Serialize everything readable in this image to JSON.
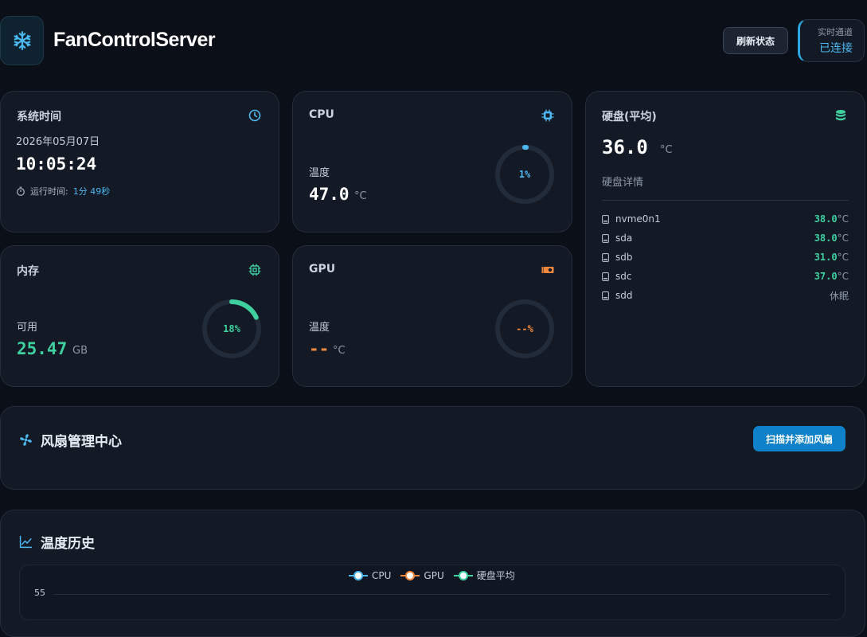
{
  "header": {
    "app_title": "FanControlServer",
    "logo_icon": "snowflake-icon",
    "refresh_label": "刷新状态",
    "connection_label": "实时通道",
    "connection_status": "已连接"
  },
  "system_time": {
    "title": "系统时间",
    "icon": "clock-icon",
    "date": "2026年05月07日",
    "time": "10:05:24",
    "uptime_label": "运行时间:",
    "uptime_value": "1分 49秒"
  },
  "cpu": {
    "title": "CPU",
    "icon": "cpu-icon",
    "temp_label": "温度",
    "temp_value": "47.0",
    "temp_unit": "°C",
    "usage_text": "1%",
    "usage_fraction": 0.01,
    "color": "#4cb8ef"
  },
  "disk_avg": {
    "title": "硬盘(平均)",
    "icon": "database-icon",
    "temp_value": "36.0",
    "temp_unit": "°C",
    "details_label": "硬盘详情",
    "disks": [
      {
        "name": "nvme0n1",
        "temp": "38.0",
        "unit": "°C"
      },
      {
        "name": "sda",
        "temp": "38.0",
        "unit": "°C"
      },
      {
        "name": "sdb",
        "temp": "31.0",
        "unit": "°C"
      },
      {
        "name": "sdc",
        "temp": "37.0",
        "unit": "°C"
      },
      {
        "name": "sdd",
        "temp": "休眠",
        "unit": ""
      }
    ]
  },
  "memory": {
    "title": "内存",
    "icon": "memory-chip-icon",
    "avail_label": "可用",
    "avail_value": "25.47",
    "avail_unit": "GB",
    "usage_text": "18%",
    "usage_fraction": 0.18,
    "color": "#3fd0a0"
  },
  "gpu": {
    "title": "GPU",
    "icon": "gpu-card-icon",
    "temp_label": "温度",
    "temp_value": "--",
    "temp_unit": "°C",
    "usage_text": "--%",
    "usage_fraction": 0,
    "color": "#f0883e"
  },
  "fan_center": {
    "title": "风扇管理中心",
    "icon": "fan-icon",
    "scan_label": "扫描并添加风扇"
  },
  "history": {
    "title": "温度历史",
    "icon": "line-chart-icon"
  },
  "chart_data": {
    "type": "line",
    "series": [
      {
        "name": "CPU",
        "color": "#4cb8ef",
        "values": []
      },
      {
        "name": "GPU",
        "color": "#f0883e",
        "values": []
      },
      {
        "name": "硬盘平均",
        "color": "#3fd0a0",
        "values": []
      }
    ],
    "yticks": [
      "55"
    ],
    "legend_position": "top-center",
    "grid": true
  }
}
